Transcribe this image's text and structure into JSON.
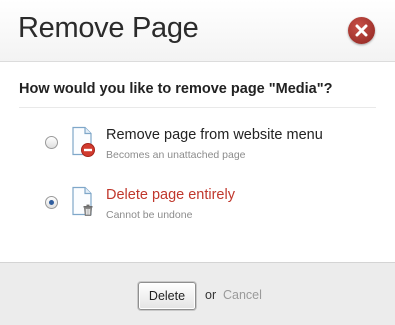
{
  "dialog": {
    "title": "Remove Page",
    "question": "How would you like to remove page \"Media\"?"
  },
  "options": [
    {
      "title": "Remove page from website menu",
      "subtitle": "Becomes an unattached page",
      "selected": false,
      "icon": "page-remove-icon"
    },
    {
      "title": "Delete page entirely",
      "subtitle": "Cannot be undone",
      "selected": true,
      "icon": "page-trash-icon"
    }
  ],
  "footer": {
    "delete_label": "Delete",
    "or_text": "or",
    "cancel_label": "Cancel"
  },
  "colors": {
    "close_button": "#b23a33",
    "danger_text": "#c0372c",
    "footer_bg": "#ececec"
  }
}
